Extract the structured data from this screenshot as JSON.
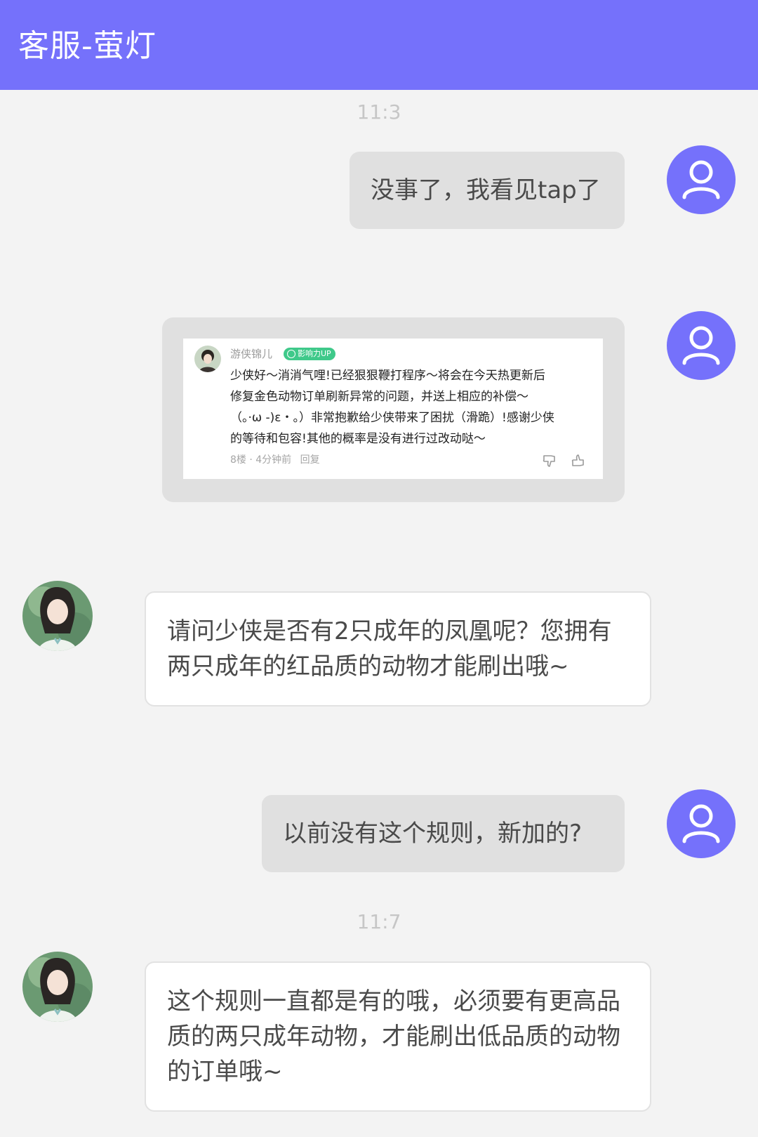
{
  "header": {
    "title": "客服-萤灯"
  },
  "chat": {
    "time_1": "11:3",
    "msg_1": "没事了，我看见tap了",
    "shared_comment": {
      "author": "游侠锦儿",
      "badge": "影响力UP",
      "lines": [
        "少侠好～消消气哩!已经狠狠鞭打程序～将会在今天热更新后",
        "修复金色动物订单刷新异常的问题，并送上相应的补偿～",
        "（。·ω -)ε・。）非常抱歉给少侠带来了困扰（滑跪）!感谢少侠",
        "的等待和包容!其他的概率是没有进行过改动哒～"
      ],
      "meta": "8楼 · 4分钟前",
      "reply": "回复",
      "icons": [
        "thumb-down-icon",
        "thumb-up-icon"
      ]
    },
    "msg_3": "请问少侠是否有2只成年的凤凰呢？您拥有两只成年的红品质的动物才能刷出哦~",
    "msg_4": "以前没有这个规则，新加的?",
    "time_2": "11:7",
    "msg_5": "这个规则一直都是有的哦，必须要有更高品质的两只成年动物，才能刷出低品质的动物的订单哦~"
  },
  "colors": {
    "accent": "#7571fb",
    "background": "#f3f3f3",
    "user_bubble": "#e0e0e0",
    "agent_bubble": "#ffffff",
    "timestamp": "#c6c6c6",
    "badge": "#3fc98a"
  }
}
